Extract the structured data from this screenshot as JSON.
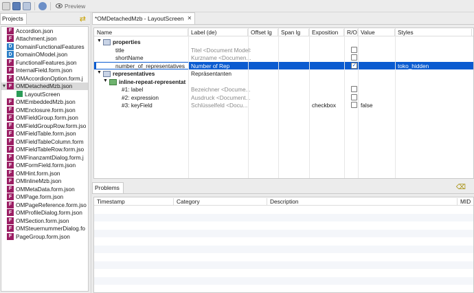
{
  "toolbar": {
    "preview_label": "Preview"
  },
  "projects": {
    "tab_label": "Projects",
    "items": [
      {
        "label": "Accordion.json",
        "icon": "F"
      },
      {
        "label": "Attachment.json",
        "icon": "F"
      },
      {
        "label": "DomainFunctionalFeatures",
        "icon": "D"
      },
      {
        "label": "DomainOModel.json",
        "icon": "D"
      },
      {
        "label": "FunctionalFeatures.json",
        "icon": "F"
      },
      {
        "label": "InternalField.form.json",
        "icon": "F"
      },
      {
        "label": "OMAccordionOption.form.j",
        "icon": "F"
      },
      {
        "label": "OMDetachedMzb.json",
        "icon": "F"
      },
      {
        "label": "LayoutScreen",
        "icon": "L"
      },
      {
        "label": "OMEmbeddedMzb.json",
        "icon": "F"
      },
      {
        "label": "OMEnclosure.form.json",
        "icon": "F"
      },
      {
        "label": "OMFieldGroup.form.json",
        "icon": "F"
      },
      {
        "label": "OMFieldGroupRow.form.jso",
        "icon": "F"
      },
      {
        "label": "OMFieldTable.form.json",
        "icon": "F"
      },
      {
        "label": "OMFieldTableColumn.form",
        "icon": "F"
      },
      {
        "label": "OMFieldTableRow.form.jso",
        "icon": "F"
      },
      {
        "label": "OMFinanzamtDialog.form.j",
        "icon": "F"
      },
      {
        "label": "OMFormField.form.json",
        "icon": "F"
      },
      {
        "label": "OMHint.form.json",
        "icon": "F"
      },
      {
        "label": "OMInlineMzb.json",
        "icon": "F"
      },
      {
        "label": "OMMetaData.form.json",
        "icon": "F"
      },
      {
        "label": "OMPage.form.json",
        "icon": "F"
      },
      {
        "label": "OMPageReference.form.jso",
        "icon": "F"
      },
      {
        "label": "OMProfileDialog.form.json",
        "icon": "F"
      },
      {
        "label": "OMSection.form.json",
        "icon": "F"
      },
      {
        "label": "OMSteuernummerDialog.fo",
        "icon": "F"
      },
      {
        "label": "PageGroup.form.json",
        "icon": "F"
      }
    ]
  },
  "editor": {
    "tab_label": "*OMDetachedMzb - LayoutScreen",
    "columns": [
      "Name",
      "Label (de)",
      "Offset lg",
      "Span lg",
      "Exposition",
      "R/O",
      "Value",
      "Styles"
    ],
    "rows": [
      {
        "name": "properties",
        "label": "",
        "exposition": "",
        "ro": null,
        "value": "",
        "styles": ""
      },
      {
        "name": "title",
        "label": "Titel <Document Model>",
        "exposition": "",
        "ro": false,
        "value": "",
        "styles": ""
      },
      {
        "name": "shortName",
        "label": "Kurzname <Documen...",
        "exposition": "",
        "ro": false,
        "value": "",
        "styles": ""
      },
      {
        "name": "number_of_representatives",
        "label": "Number of Rep",
        "exposition": "",
        "ro": true,
        "value": "",
        "styles": "toko_hidden"
      },
      {
        "name": "representatives",
        "label": "Repräsentanten",
        "exposition": "",
        "ro": null,
        "value": "",
        "styles": ""
      },
      {
        "name": "inline-repeat-representat",
        "label": "",
        "exposition": "",
        "ro": null,
        "value": "",
        "styles": ""
      },
      {
        "name": "#1: label",
        "label": "Bezeichner <Docume...",
        "exposition": "",
        "ro": false,
        "value": "",
        "styles": ""
      },
      {
        "name": "#2: expression",
        "label": "Ausdruck <Document...",
        "exposition": "",
        "ro": false,
        "value": "",
        "styles": ""
      },
      {
        "name": "#3: keyField",
        "label": "Schlüsselfeld <Docu...",
        "exposition": "checkbox",
        "ro": false,
        "value": "false",
        "styles": ""
      }
    ]
  },
  "problems": {
    "tab_label": "Problems",
    "columns": [
      "Timestamp",
      "Category",
      "Description",
      "MID"
    ]
  }
}
